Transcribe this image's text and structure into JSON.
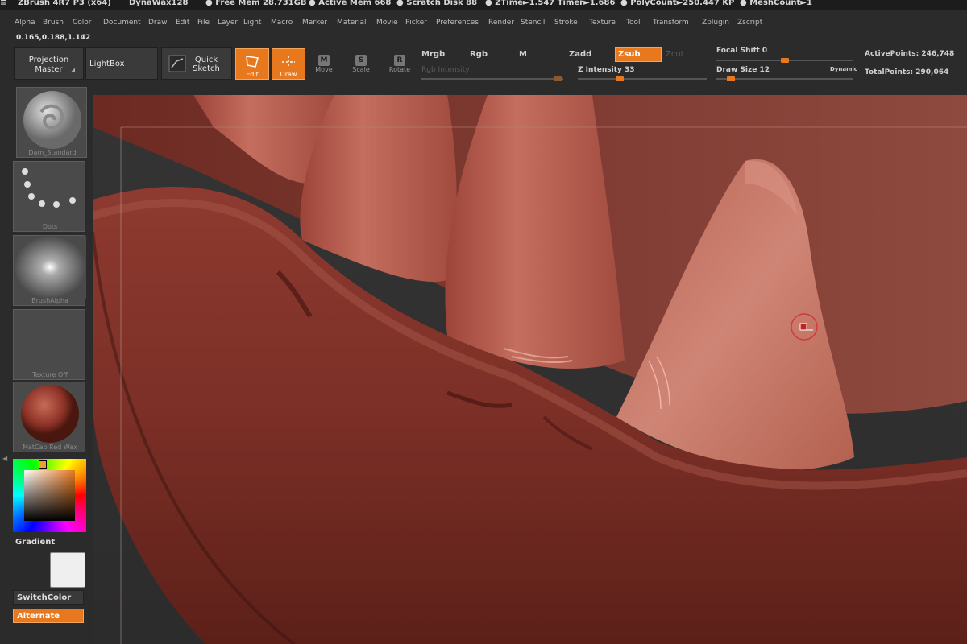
{
  "titlebar": {
    "app": "ZBrush 4R7 P3 (x64)",
    "doc": "DynaWax128",
    "free_mem": "Free Mem 28.731GB",
    "active_mem": "Active Mem 668",
    "scratch": "Scratch Disk 88",
    "ztime": "ZTime►1.547 Timer►1.686",
    "polycount": "PolyCount►250.447 KP",
    "meshcount": "MeshCount►1"
  },
  "menu": [
    "Alpha",
    "Brush",
    "Color",
    "Document",
    "Draw",
    "Edit",
    "File",
    "Layer",
    "Light",
    "Macro",
    "Marker",
    "Material",
    "Movie",
    "Picker",
    "Preferences",
    "Render",
    "Stencil",
    "Stroke",
    "Texture",
    "Tool",
    "Transform",
    "Zplugin",
    "Zscript"
  ],
  "coords": "0.165,0.188,1.142",
  "toolbar": {
    "projection_master": "Projection Master",
    "lightbox": "LightBox",
    "quick_sketch": "Quick Sketch",
    "edit": "Edit",
    "draw": "Draw",
    "move": "Move",
    "scale": "Scale",
    "rotate": "Rotate",
    "move_key": "M",
    "scale_key": "S",
    "rotate_key": "R",
    "mrgb": "Mrgb",
    "rgb": "Rgb",
    "m": "M",
    "zadd": "Zadd",
    "zsub": "Zsub",
    "zcut": "Zcut",
    "rgb_intensity": "Rgb Intensity",
    "z_intensity": "Z Intensity 33",
    "focal_shift": "Focal Shift 0",
    "draw_size": "Draw Size 12",
    "dynamic": "Dynamic",
    "active_points": "ActivePoints: 246,748",
    "total_points": "TotalPoints: 290,064"
  },
  "sliders": {
    "z_intensity": 0.33,
    "focal_shift": 0.5,
    "draw_size": 0.04
  },
  "tray": {
    "brush": "Dam_Standard",
    "stroke": "Dots",
    "alpha": "BrushAlpha",
    "texture": "Texture Off",
    "material": "MatCap Red Wax",
    "gradient": "Gradient",
    "switchcolor": "SwitchColor",
    "alternate": "Alternate"
  },
  "colors": {
    "accent": "#e8781e",
    "wax": "#a9473c"
  }
}
